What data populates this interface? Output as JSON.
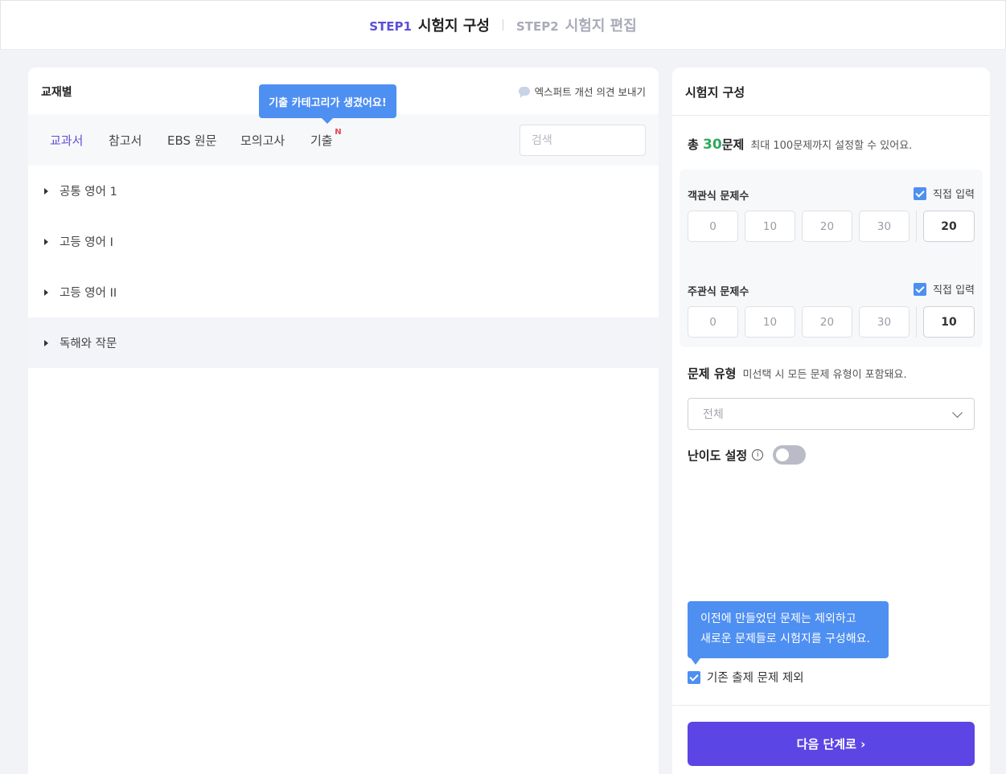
{
  "steps": [
    {
      "num": "STEP1",
      "title": "시험지 구성"
    },
    {
      "num": "STEP2",
      "title": "시험지 편집"
    }
  ],
  "left": {
    "title": "교재별",
    "expert_link": "엑스퍼트 개선 의견 보내기",
    "new_tooltip": "기출 카테고리가 생겼어요!",
    "tabs": [
      {
        "label": "교과서"
      },
      {
        "label": "참고서"
      },
      {
        "label": "EBS 원문"
      },
      {
        "label": "모의고사"
      },
      {
        "label": "기출",
        "badge": "N"
      }
    ],
    "search_placeholder": "검색",
    "tree": [
      "공통 영어 1",
      "고등 영어 I",
      "고등 영어 II",
      "독해와 작문"
    ]
  },
  "right": {
    "title": "시험지 구성",
    "total_prefix": "총",
    "total_num": "30",
    "total_suffix": "문제",
    "total_hint": "최대 100문제까지 설정할 수 있어요.",
    "objective": {
      "label": "객관식 문제수",
      "direct_label": "직접 입력",
      "options": [
        "0",
        "10",
        "20",
        "30"
      ],
      "value": "20"
    },
    "subjective": {
      "label": "주관식 문제수",
      "direct_label": "직접 입력",
      "options": [
        "0",
        "10",
        "20",
        "30"
      ],
      "value": "10"
    },
    "type_label": "문제 유형",
    "type_hint": "미선택 시 모든 문제 유형이 포함돼요.",
    "type_select": "전체",
    "difficulty_label": "난이도 설정",
    "info_icon_glyph": "i",
    "tip_line1": "이전에 만들었던 문제는 제외하고",
    "tip_line2": "새로운 문제들로 시험지를 구성해요.",
    "exclude_label": "기존 출제 문제 제외",
    "next_button": "다음 단계로 ›"
  },
  "colors": {
    "accent": "#5b4fd6",
    "primary_button": "#5b45e4",
    "tooltip": "#4e8ff2",
    "total_number": "#2daa5c",
    "new_badge": "#e5484d"
  }
}
